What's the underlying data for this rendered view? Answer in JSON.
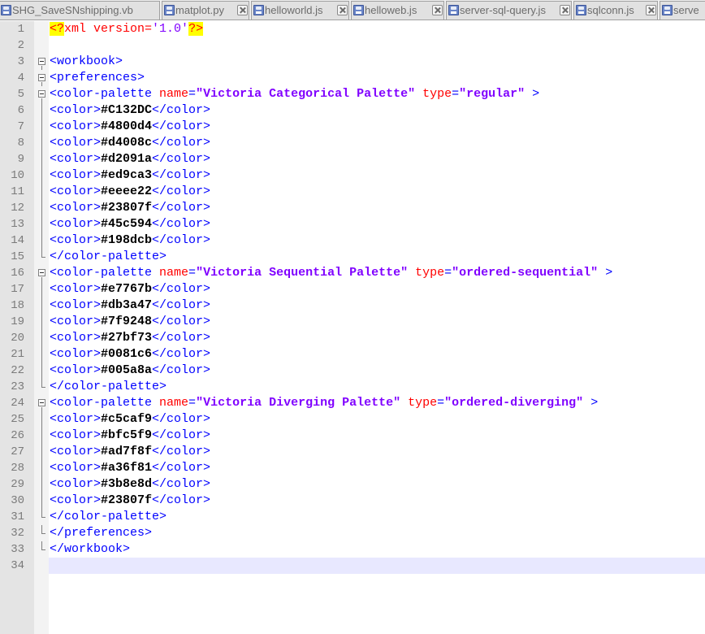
{
  "tabs": [
    {
      "label": "SHG_SaveSNshipping.vb",
      "icon": "file-icon",
      "close": false
    },
    {
      "label": "matplot.py",
      "icon": "file-icon",
      "close": true
    },
    {
      "label": "helloworld.js",
      "icon": "file-icon",
      "close": true
    },
    {
      "label": "helloweb.js",
      "icon": "file-icon",
      "close": true
    },
    {
      "label": "server-sql-query.js",
      "icon": "file-icon",
      "close": true
    },
    {
      "label": "sqlconn.js",
      "icon": "file-icon",
      "close": true
    },
    {
      "label": "serve",
      "icon": "file-icon",
      "close": false
    }
  ],
  "colors": {
    "tag": "#0000ff",
    "attribute": "#ff0000",
    "attribute_value": "#8000ff",
    "text": "#000000",
    "current_line": "#e8e8ff",
    "gutter": "#e4e4e4"
  },
  "current_line": 34,
  "lines": [
    {
      "n": "1",
      "fold": "none",
      "tokens": [
        [
          "pi",
          "<?"
        ],
        [
          "pin",
          "xml version="
        ],
        [
          "pistr",
          "'1.0'"
        ],
        [
          "pi",
          "?>"
        ]
      ]
    },
    {
      "n": "2",
      "fold": "none",
      "tokens": []
    },
    {
      "n": "3",
      "fold": "open",
      "tokens": [
        [
          "tag",
          "<workbook>"
        ]
      ]
    },
    {
      "n": "4",
      "fold": "open",
      "tokens": [
        [
          "tag",
          "<preferences>"
        ]
      ]
    },
    {
      "n": "5",
      "fold": "open",
      "tokens": [
        [
          "tag",
          "<color-palette "
        ],
        [
          "attr",
          "name"
        ],
        [
          "tag",
          "="
        ],
        [
          "str",
          "\"Victoria Categorical Palette\""
        ],
        [
          "tag",
          " "
        ],
        [
          "attr",
          "type"
        ],
        [
          "tag",
          "="
        ],
        [
          "str",
          "\"regular\""
        ],
        [
          "tag",
          " >"
        ]
      ]
    },
    {
      "n": "6",
      "fold": "line",
      "tokens": [
        [
          "tag",
          "<color>"
        ],
        [
          "txt",
          "#C132DC"
        ],
        [
          "tag",
          "</color>"
        ]
      ]
    },
    {
      "n": "7",
      "fold": "line",
      "tokens": [
        [
          "tag",
          "<color>"
        ],
        [
          "txt",
          "#4800d4"
        ],
        [
          "tag",
          "</color>"
        ]
      ]
    },
    {
      "n": "8",
      "fold": "line",
      "tokens": [
        [
          "tag",
          "<color>"
        ],
        [
          "txt",
          "#d4008c"
        ],
        [
          "tag",
          "</color>"
        ]
      ]
    },
    {
      "n": "9",
      "fold": "line",
      "tokens": [
        [
          "tag",
          "<color>"
        ],
        [
          "txt",
          "#d2091a"
        ],
        [
          "tag",
          "</color>"
        ]
      ]
    },
    {
      "n": "10",
      "fold": "line",
      "tokens": [
        [
          "tag",
          "<color>"
        ],
        [
          "txt",
          "#ed9ca3"
        ],
        [
          "tag",
          "</color>"
        ]
      ]
    },
    {
      "n": "11",
      "fold": "line",
      "tokens": [
        [
          "tag",
          "<color>"
        ],
        [
          "txt",
          "#eeee22"
        ],
        [
          "tag",
          "</color>"
        ]
      ]
    },
    {
      "n": "12",
      "fold": "line",
      "tokens": [
        [
          "tag",
          "<color>"
        ],
        [
          "txt",
          "#23807f"
        ],
        [
          "tag",
          "</color>"
        ]
      ]
    },
    {
      "n": "13",
      "fold": "line",
      "tokens": [
        [
          "tag",
          "<color>"
        ],
        [
          "txt",
          "#45c594"
        ],
        [
          "tag",
          "</color>"
        ]
      ]
    },
    {
      "n": "14",
      "fold": "line",
      "tokens": [
        [
          "tag",
          "<color>"
        ],
        [
          "txt",
          "#198dcb"
        ],
        [
          "tag",
          "</color>"
        ]
      ]
    },
    {
      "n": "15",
      "fold": "end",
      "tokens": [
        [
          "tag",
          "</color-palette>"
        ]
      ]
    },
    {
      "n": "16",
      "fold": "open",
      "tokens": [
        [
          "tag",
          "<color-palette "
        ],
        [
          "attr",
          "name"
        ],
        [
          "tag",
          "="
        ],
        [
          "str",
          "\"Victoria Sequential Palette\""
        ],
        [
          "tag",
          " "
        ],
        [
          "attr",
          "type"
        ],
        [
          "tag",
          "="
        ],
        [
          "str",
          "\"ordered-sequential\""
        ],
        [
          "tag",
          " >"
        ]
      ]
    },
    {
      "n": "17",
      "fold": "line",
      "tokens": [
        [
          "tag",
          "<color>"
        ],
        [
          "txt",
          "#e7767b"
        ],
        [
          "tag",
          "</color>"
        ]
      ]
    },
    {
      "n": "18",
      "fold": "line",
      "tokens": [
        [
          "tag",
          "<color>"
        ],
        [
          "txt",
          "#db3a47"
        ],
        [
          "tag",
          "</color>"
        ]
      ]
    },
    {
      "n": "19",
      "fold": "line",
      "tokens": [
        [
          "tag",
          "<color>"
        ],
        [
          "txt",
          "#7f9248"
        ],
        [
          "tag",
          "</color>"
        ]
      ]
    },
    {
      "n": "20",
      "fold": "line",
      "tokens": [
        [
          "tag",
          "<color>"
        ],
        [
          "txt",
          "#27bf73"
        ],
        [
          "tag",
          "</color>"
        ]
      ]
    },
    {
      "n": "21",
      "fold": "line",
      "tokens": [
        [
          "tag",
          "<color>"
        ],
        [
          "txt",
          "#0081c6"
        ],
        [
          "tag",
          "</color>"
        ]
      ]
    },
    {
      "n": "22",
      "fold": "line",
      "tokens": [
        [
          "tag",
          "<color>"
        ],
        [
          "txt",
          "#005a8a"
        ],
        [
          "tag",
          "</color>"
        ]
      ]
    },
    {
      "n": "23",
      "fold": "end",
      "tokens": [
        [
          "tag",
          "</color-palette>"
        ]
      ]
    },
    {
      "n": "24",
      "fold": "open",
      "tokens": [
        [
          "tag",
          "<color-palette "
        ],
        [
          "attr",
          "name"
        ],
        [
          "tag",
          "="
        ],
        [
          "str",
          "\"Victoria Diverging Palette\""
        ],
        [
          "tag",
          " "
        ],
        [
          "attr",
          "type"
        ],
        [
          "tag",
          "="
        ],
        [
          "str",
          "\"ordered-diverging\""
        ],
        [
          "tag",
          " >"
        ]
      ]
    },
    {
      "n": "25",
      "fold": "line",
      "tokens": [
        [
          "tag",
          "<color>"
        ],
        [
          "txt",
          "#c5caf9"
        ],
        [
          "tag",
          "</color>"
        ]
      ]
    },
    {
      "n": "26",
      "fold": "line",
      "tokens": [
        [
          "tag",
          "<color>"
        ],
        [
          "txt",
          "#bfc5f9"
        ],
        [
          "tag",
          "</color>"
        ]
      ]
    },
    {
      "n": "27",
      "fold": "line",
      "tokens": [
        [
          "tag",
          "<color>"
        ],
        [
          "txt",
          "#ad7f8f"
        ],
        [
          "tag",
          "</color>"
        ]
      ]
    },
    {
      "n": "28",
      "fold": "line",
      "tokens": [
        [
          "tag",
          "<color>"
        ],
        [
          "txt",
          "#a36f81"
        ],
        [
          "tag",
          "</color>"
        ]
      ]
    },
    {
      "n": "29",
      "fold": "line",
      "tokens": [
        [
          "tag",
          "<color>"
        ],
        [
          "txt",
          "#3b8e8d"
        ],
        [
          "tag",
          "</color>"
        ]
      ]
    },
    {
      "n": "30",
      "fold": "line",
      "tokens": [
        [
          "tag",
          "<color>"
        ],
        [
          "txt",
          "#23807f"
        ],
        [
          "tag",
          "</color>"
        ]
      ]
    },
    {
      "n": "31",
      "fold": "end",
      "tokens": [
        [
          "tag",
          "</color-palette>"
        ]
      ]
    },
    {
      "n": "32",
      "fold": "end",
      "tokens": [
        [
          "tag",
          "</preferences>"
        ]
      ]
    },
    {
      "n": "33",
      "fold": "end",
      "tokens": [
        [
          "tag",
          "</workbook>"
        ]
      ]
    },
    {
      "n": "34",
      "fold": "none",
      "tokens": []
    }
  ]
}
